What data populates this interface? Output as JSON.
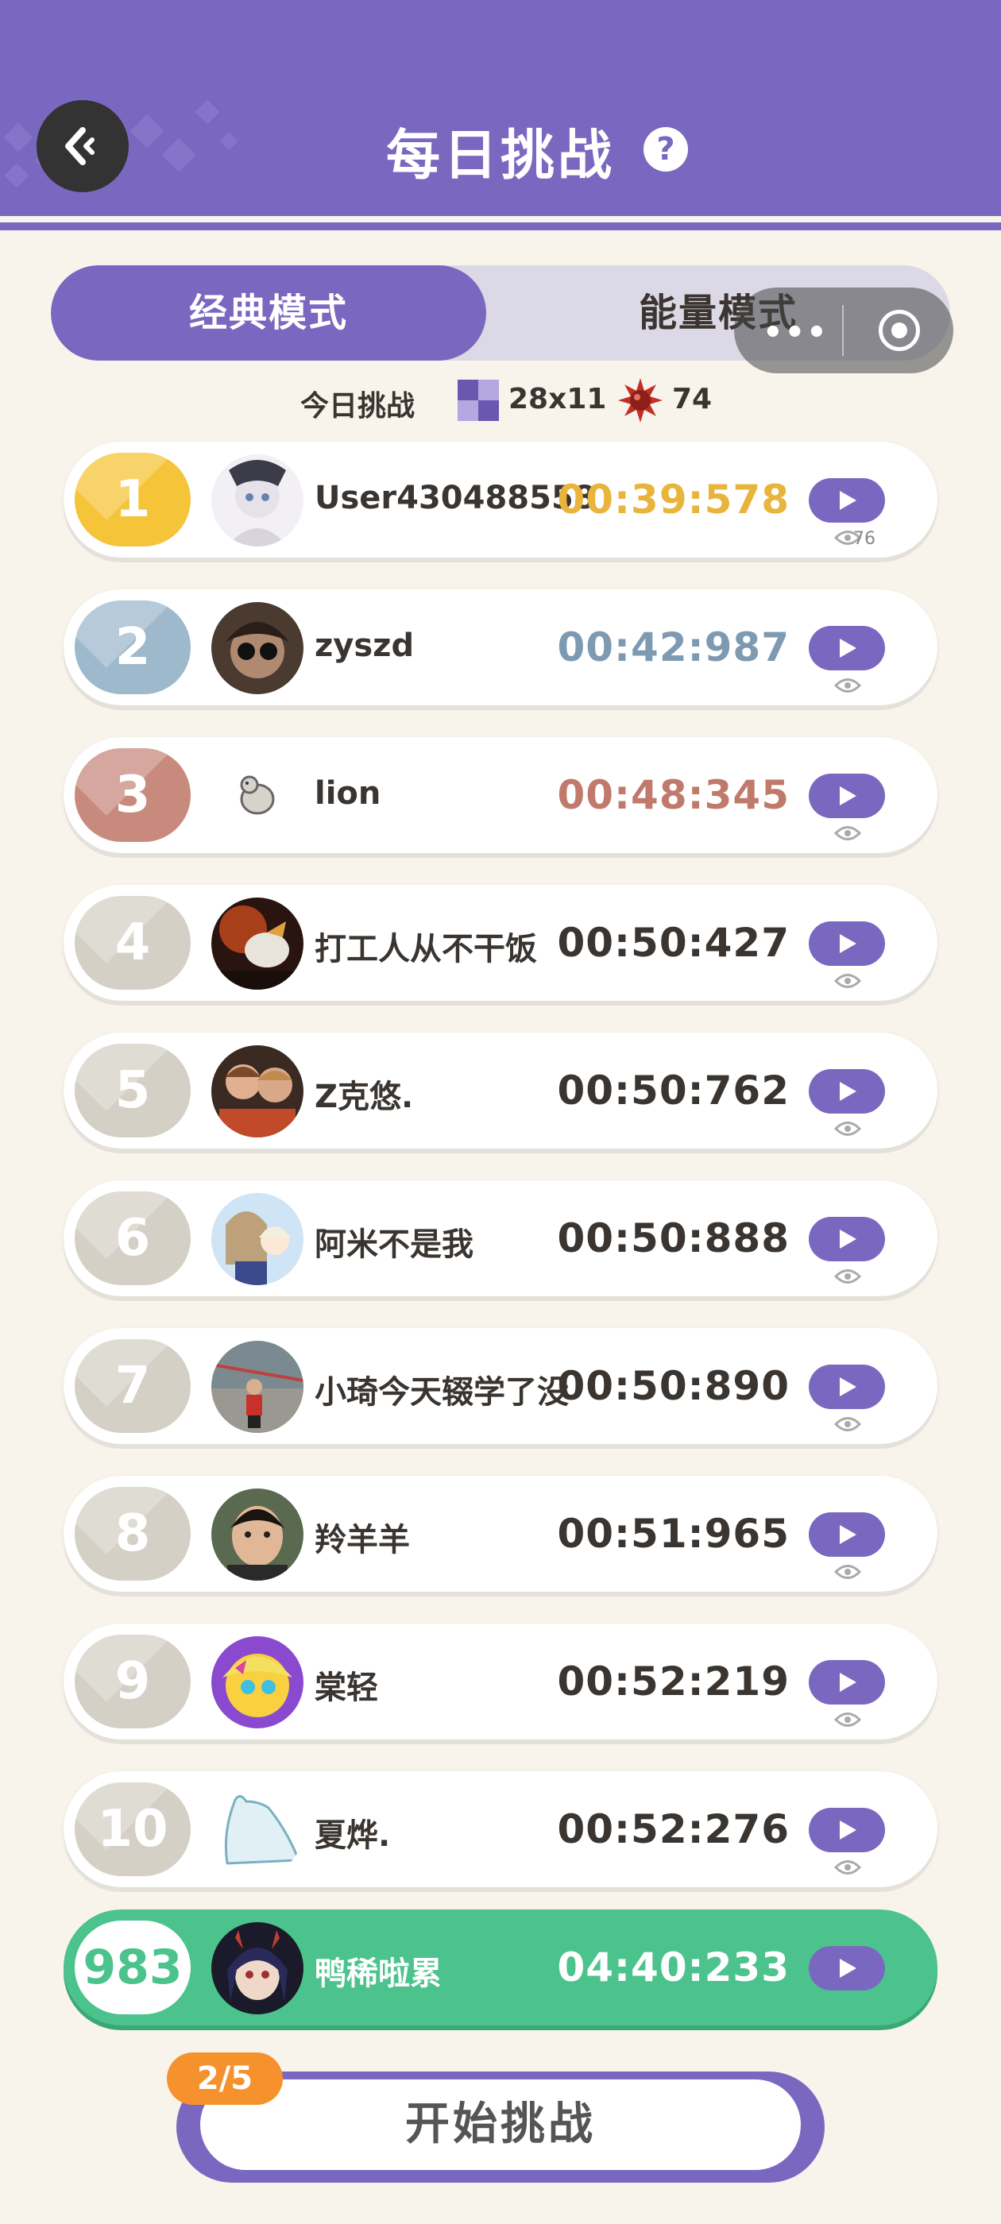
{
  "header": {
    "title": "每日挑战",
    "help_icon": "question-circle-icon",
    "back_icon": "back-arrow-icon"
  },
  "tabs": [
    {
      "label": "经典模式",
      "active": true
    },
    {
      "label": "能量模式",
      "active": false
    }
  ],
  "capsule": {
    "dots": "•••"
  },
  "info": {
    "label": "今日挑战",
    "grid_size": "28x11",
    "mine_count": "74"
  },
  "rows": [
    {
      "rank": "1",
      "name": "User430488558",
      "time": "00:39:578",
      "views": "76",
      "tier": "gold"
    },
    {
      "rank": "2",
      "name": "zyszd",
      "time": "00:42:987",
      "tier": "silver"
    },
    {
      "rank": "3",
      "name": "lion",
      "time": "00:48:345",
      "tier": "bronze"
    },
    {
      "rank": "4",
      "name": "打工人从不干饭",
      "time": "00:50:427",
      "tier": "normal"
    },
    {
      "rank": "5",
      "name": "Z克悠.",
      "time": "00:50:762",
      "tier": "normal"
    },
    {
      "rank": "6",
      "name": "阿米不是我",
      "time": "00:50:888",
      "tier": "normal"
    },
    {
      "rank": "7",
      "name": "小琦今天辍学了没",
      "time": "00:50:890",
      "tier": "normal"
    },
    {
      "rank": "8",
      "name": "羚羊羊",
      "time": "00:51:965",
      "tier": "normal"
    },
    {
      "rank": "9",
      "name": "棠轻",
      "time": "00:52:219",
      "tier": "normal"
    },
    {
      "rank": "10",
      "name": "夏烨.",
      "time": "00:52:276",
      "tier": "normal"
    }
  ],
  "me": {
    "rank": "983",
    "name": "鸭稀啦累",
    "time": "04:40:233"
  },
  "start": {
    "label": "开始挑战",
    "counter": "2/5"
  },
  "colors": {
    "primary": "#7a68c0",
    "gold": "#f5c438",
    "silver": "#9eb8cc",
    "bronze": "#c98a7e",
    "me_green": "#4cc38c",
    "accent_orange": "#f5922e"
  }
}
